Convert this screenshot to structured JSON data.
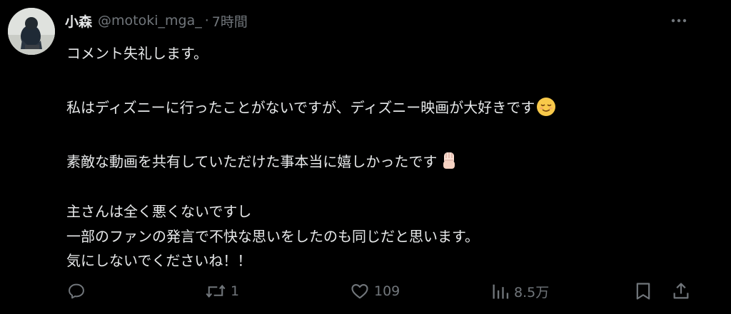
{
  "tweet": {
    "author_name": "小森",
    "handle": "@motoki_mga_",
    "separator": "·",
    "time": "7時間",
    "lines": [
      "コメント失礼します。",
      "私はディズニーに行ったことがないですが、ディズニー映画が大好きです",
      "素敵な動画を共有していただけた事本当に嬉しかったです",
      "主さんは全く悪くないですし",
      "一部のファンの発言で不快な思いをしたのも同じだと思います。",
      "気にしないでくださいね！！"
    ],
    "emojis": [
      "relieved-face-emoji",
      "raised-fist-emoji"
    ]
  },
  "actions": {
    "reply": {
      "icon": "reply-icon",
      "count": ""
    },
    "retweet": {
      "icon": "retweet-icon",
      "count": "1"
    },
    "like": {
      "icon": "heart-icon",
      "count": "109"
    },
    "views": {
      "icon": "views-icon",
      "count": "8.5万"
    },
    "bookmark": {
      "icon": "bookmark-icon"
    },
    "share": {
      "icon": "share-icon"
    }
  },
  "colors": {
    "background": "#000000",
    "text": "#e7e9ea",
    "secondary": "#71767b"
  }
}
